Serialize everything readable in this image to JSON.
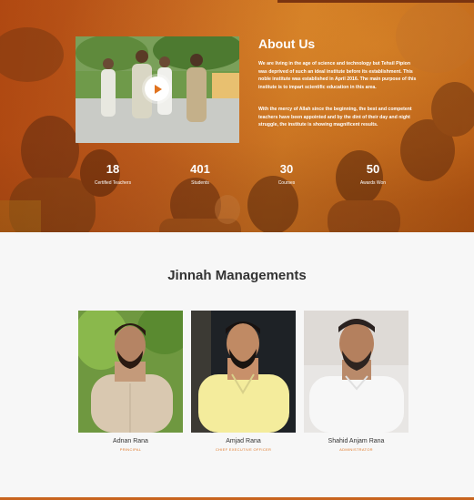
{
  "about": {
    "title": "About Us",
    "paragraph_1": "We are living in the age of science and technology but Tehsil Pipion was deprived of such an ideal institute before its establishment. This noble institute was established in April 2016. The main purpose of this institute is to impart scientific education in this area.",
    "paragraph_2": "With the mercy of Allah since the beginning, the best and competent teachers have been appointed and by the dint of their day and night struggle, the institute is showing magnificent results.",
    "video_play_icon": "play-icon"
  },
  "stats": [
    {
      "value": "18",
      "label": "Certified Teachers"
    },
    {
      "value": "401",
      "label": "Students"
    },
    {
      "value": "30",
      "label": "Courses"
    },
    {
      "value": "50",
      "label": "Awards Won"
    }
  ],
  "management": {
    "title": "Jinnah Managements",
    "members": [
      {
        "name": "Adnan Rana",
        "role": "PRINCIPAL"
      },
      {
        "name": "Amjad Rana",
        "role": "CHIEF EXECUTIVE OFFICER"
      },
      {
        "name": "Shahid Anjam Rana",
        "role": "ADMINISTRATOR"
      }
    ]
  },
  "colors": {
    "accent": "#e07a2a",
    "hero_overlay": "#c4621f",
    "heading": "#333333"
  }
}
